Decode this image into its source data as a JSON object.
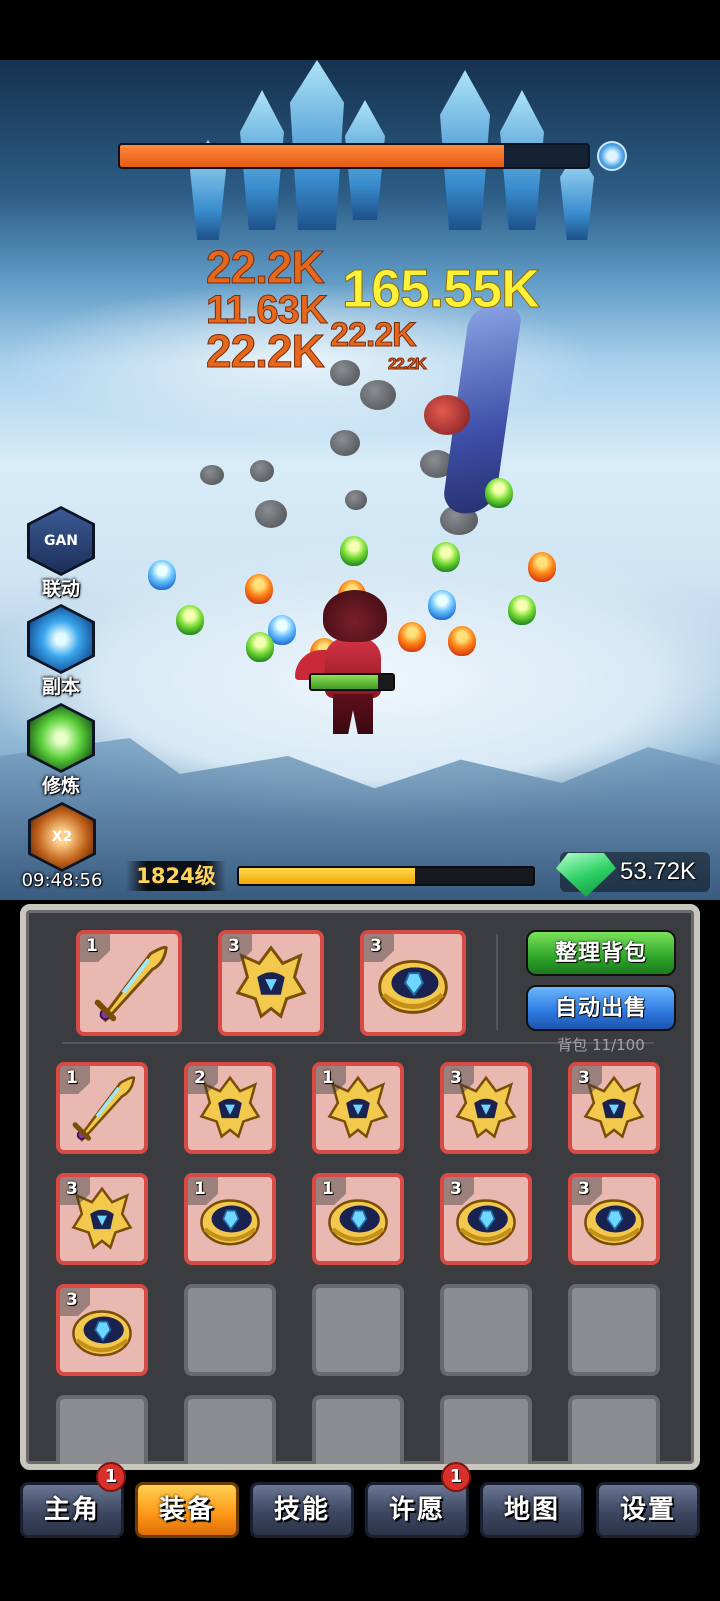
{
  "battle": {
    "boss_hp_fraction": 0.82,
    "hero_hp_fraction": 0.82,
    "damage_numbers": [
      "22.2K",
      "11.63K",
      "22.2K",
      "22.2K",
      "22.2K",
      "165.55K"
    ]
  },
  "side_menu": [
    {
      "id": "link",
      "label": "联动",
      "icon": "link-event-icon",
      "icon_text": "GAN"
    },
    {
      "id": "dungeon",
      "label": "副本",
      "icon": "portal-vortex-icon"
    },
    {
      "id": "cultivate",
      "label": "修炼",
      "icon": "cultivation-swirl-icon"
    },
    {
      "id": "double",
      "label": "09:48:56",
      "icon": "x2-boost-icon",
      "icon_text": "X2"
    }
  ],
  "status": {
    "level_label": "1824级",
    "xp_fraction": 0.6,
    "gems": "53.72K"
  },
  "inventory": {
    "sort_label": "整理背包",
    "auto_sell_label": "自动出售",
    "bag_label": "背包 11/100",
    "equipped": [
      {
        "count": "1",
        "item": "sword-icon"
      },
      {
        "count": "3",
        "item": "helmet-icon"
      },
      {
        "count": "3",
        "item": "crown-icon"
      }
    ],
    "slots": [
      {
        "count": "1",
        "item": "sword-icon"
      },
      {
        "count": "2",
        "item": "helmet-icon"
      },
      {
        "count": "1",
        "item": "helmet-icon"
      },
      {
        "count": "3",
        "item": "helmet-icon"
      },
      {
        "count": "3",
        "item": "helmet-icon"
      },
      {
        "count": "3",
        "item": "helmet-icon"
      },
      {
        "count": "1",
        "item": "crown-icon"
      },
      {
        "count": "1",
        "item": "crown-icon"
      },
      {
        "count": "3",
        "item": "crown-icon"
      },
      {
        "count": "3",
        "item": "crown-icon"
      },
      {
        "count": "3",
        "item": "crown-icon"
      }
    ]
  },
  "nav": [
    {
      "label": "主角",
      "badge": "1",
      "active": false
    },
    {
      "label": "装备",
      "badge": "",
      "active": true
    },
    {
      "label": "技能",
      "badge": "",
      "active": false
    },
    {
      "label": "许愿",
      "badge": "1",
      "active": false
    },
    {
      "label": "地图",
      "badge": "",
      "active": false
    },
    {
      "label": "设置",
      "badge": "",
      "active": false
    }
  ],
  "colors": {
    "accent_active_tab": "#ff9a1a",
    "slot_border": "#d84a45",
    "sort_button": "#2fa52a",
    "sell_button": "#2d78e0",
    "level_text": "#ffd35a",
    "big_damage": "#fff13a",
    "damage": "#e4671e"
  }
}
